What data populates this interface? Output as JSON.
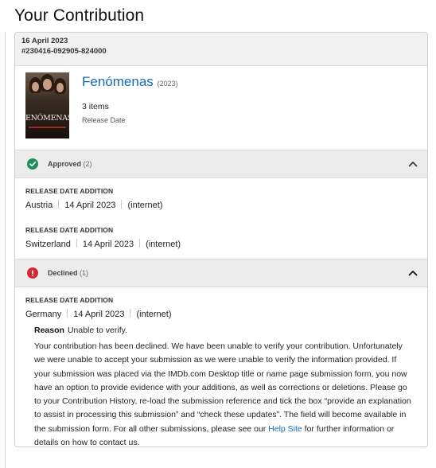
{
  "page": {
    "title": "Your Contribution"
  },
  "submission": {
    "date": "16 April 2023",
    "reference": "#230416-092905-824000"
  },
  "title_info": {
    "poster_text": "ENÓMENAS",
    "name": "Fenómenas",
    "year": "(2023)",
    "items_count": "3 items",
    "item_type": "Release Date"
  },
  "approved": {
    "label": "Approved",
    "count": "(2)",
    "entries": [
      {
        "type": "RELEASE DATE ADDITION",
        "country": "Austria",
        "date": "14 April 2023",
        "note": "(internet)"
      },
      {
        "type": "RELEASE DATE ADDITION",
        "country": "Switzerland",
        "date": "14 April 2023",
        "note": "(internet)"
      }
    ]
  },
  "declined": {
    "label": "Declined",
    "count": "(1)",
    "entries": [
      {
        "type": "RELEASE DATE ADDITION",
        "country": "Germany",
        "date": "14 April 2023",
        "note": "(internet)"
      }
    ],
    "reason_label": "Reason",
    "reason_value": "Unable to verify.",
    "reason_body": "Your contribution has been declined.  We have been unable to verify your contribution. Unfortunately we were unable to accept your submission as we were unable to verify the information provided. If your submission was placed via the IMDb.com Desktop title or name page submission form, you now have an option to provide evidence with your additions, as well as corrections or deletions. Please go to your Contribution History, re-load the submission reference and tick the box “provide an explanation to assist in processing this submission” and “check these updates”. The field will become available in the submission form. For all other submissions, please see our",
    "help_link": "Help Site",
    "reason_tail": "for further information or details on how to contact us."
  },
  "colors": {
    "link": "#136cb2",
    "approved": "#1e8e5a",
    "declined": "#d12a37",
    "bar_bg": "#ececec"
  },
  "icons": {
    "approved": "check-circle-icon",
    "declined": "alert-circle-icon",
    "collapse": "chevron-up-icon"
  }
}
